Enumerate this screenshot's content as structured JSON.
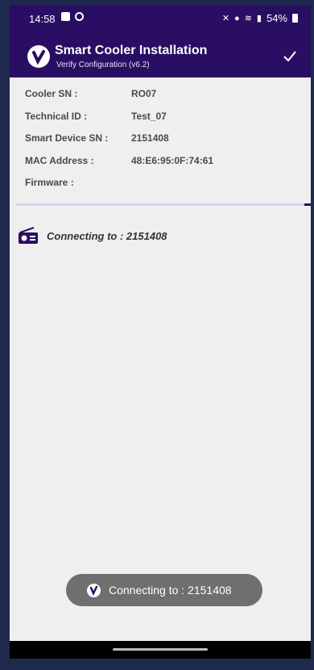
{
  "status_bar": {
    "time": "14:58",
    "battery": "54%",
    "icons": [
      "gallery-icon",
      "settings-circle-icon",
      "mute-icon",
      "location-icon",
      "wifi-icon",
      "signal-icon",
      "battery-icon"
    ]
  },
  "app_bar": {
    "title": "Smart Cooler Installation",
    "subtitle": "Verify Configuration (v6.2)",
    "confirm_icon": "check-icon"
  },
  "details": [
    {
      "label": "Cooler SN :",
      "value": "RO07"
    },
    {
      "label": "Technical ID :",
      "value": "Test_07"
    },
    {
      "label": "Smart Device SN :",
      "value": "2151408"
    },
    {
      "label": "MAC Address :",
      "value": "48:E6:95:0F:74:61"
    },
    {
      "label": "Firmware :",
      "value": ""
    }
  ],
  "connection": {
    "status_text": "Connecting to : 2151408",
    "icon": "radio-icon"
  },
  "toast": {
    "text": "Connecting to : 2151408"
  },
  "colors": {
    "primary": "#2a0e63",
    "background": "#efefef",
    "toast": "#6f6f6f"
  }
}
